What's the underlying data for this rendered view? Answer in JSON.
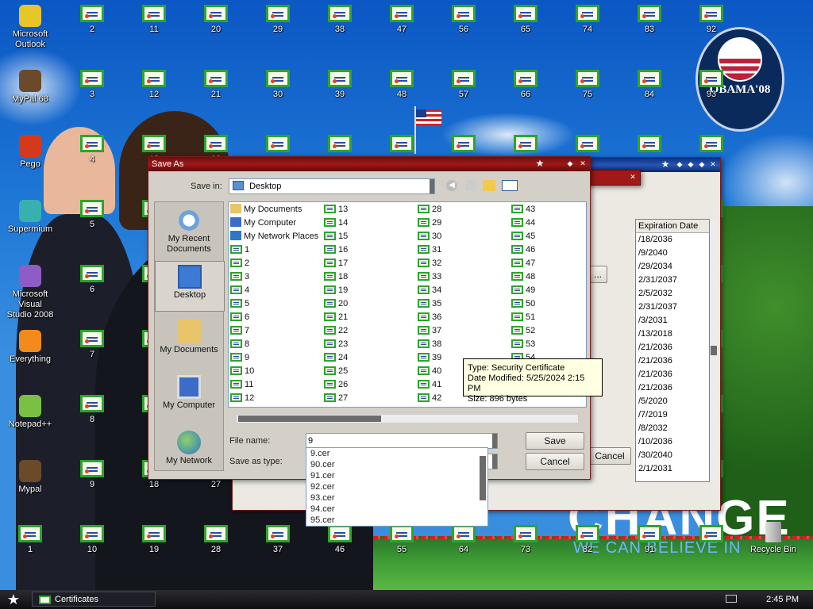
{
  "desktop": {
    "left_icons": [
      {
        "label": "Microsoft\nOutlook",
        "icon": "outlook-icon",
        "color": "#e8c62a"
      },
      {
        "label": "MyPal 68",
        "icon": "mypal-icon",
        "color": "#6b4a2a"
      },
      {
        "label": "Pego",
        "icon": "pego-icon",
        "color": "#d43a1a"
      },
      {
        "label": "Supermium",
        "icon": "supermium-icon",
        "color": "#38b0b0"
      },
      {
        "label": "Microsoft Visual\nStudio 2008",
        "icon": "visual-studio-icon",
        "color": "#8e5cc4"
      },
      {
        "label": "Everything",
        "icon": "everything-icon",
        "color": "#f28a1c"
      },
      {
        "label": "Notepad++",
        "icon": "notepadpp-icon",
        "color": "#7ac143"
      },
      {
        "label": "Mypal",
        "icon": "mypal-icon",
        "color": "#6b4a2a"
      },
      {
        "label": "1",
        "icon": "certificate-icon",
        "color": "#2da52d"
      }
    ],
    "cert_columns": [
      {
        "labels": [
          "2",
          "3",
          "4",
          "5",
          "6",
          "7",
          "8",
          "9",
          "10"
        ]
      },
      {
        "labels": [
          "11",
          "12",
          "13",
          "14",
          "15",
          "16",
          "17",
          "18",
          "19"
        ]
      },
      {
        "labels": [
          "20",
          "21",
          "22",
          "23",
          "24",
          "25",
          "26",
          "27",
          "28"
        ]
      },
      {
        "labels": [
          "29",
          "30",
          "",
          "",
          "",
          "",
          "",
          "",
          "37"
        ]
      },
      {
        "labels": [
          "38",
          "39",
          "",
          "",
          "",
          "",
          "",
          "",
          "46"
        ]
      },
      {
        "labels": [
          "47",
          "48",
          "",
          "",
          "",
          "",
          "",
          "",
          "55"
        ]
      },
      {
        "labels": [
          "56",
          "57",
          "",
          "",
          "",
          "",
          "",
          "",
          "64"
        ]
      },
      {
        "labels": [
          "65",
          "66",
          "",
          "",
          "",
          "",
          "",
          "",
          "73"
        ]
      },
      {
        "labels": [
          "74",
          "75",
          "",
          "",
          "",
          "",
          "",
          "",
          "82"
        ]
      },
      {
        "labels": [
          "83",
          "84",
          "",
          "",
          "",
          "",
          "",
          "",
          "91"
        ]
      },
      {
        "labels": [
          "92",
          "93",
          "",
          "",
          "",
          "",
          "",
          "",
          ""
        ]
      }
    ],
    "recycle_bin": "Recycle Bin",
    "obama_logo_text": "OBAMA'08",
    "wallpaper_text": "CHANGE",
    "wallpaper_subtext": "WE CAN BELIEVE IN"
  },
  "back_window": {
    "expiration_header": "Expiration Date",
    "expiration_dates": [
      "/18/2036",
      "/9/2040",
      "/29/2034",
      "2/31/2037",
      "2/5/2032",
      "2/31/2037",
      "/3/2031",
      "/13/2018",
      "/21/2036",
      "/21/2036",
      "/21/2036",
      "/21/2036",
      "/5/2020",
      "/7/2019",
      "/8/2032",
      "/10/2036",
      "/30/2040",
      "2/1/2031"
    ],
    "button_fragment": "...",
    "cancel_fragment": "Cancel"
  },
  "save_dialog": {
    "title": "Save As",
    "save_in_label": "Save in:",
    "save_in_value": "Desktop",
    "places": [
      "My Recent\nDocuments",
      "Desktop",
      "My Documents",
      "My Computer",
      "My Network"
    ],
    "special_items": [
      "My Documents",
      "My Computer",
      "My Network Places"
    ],
    "file_columns": [
      [
        "1",
        "2",
        "3",
        "4",
        "5",
        "6",
        "7",
        "8",
        "9",
        "10",
        "11",
        "12"
      ],
      [
        "13",
        "14",
        "15",
        "16",
        "17",
        "18",
        "19",
        "20",
        "21",
        "22",
        "23",
        "24",
        "25",
        "26",
        "27"
      ],
      [
        "28",
        "29",
        "30",
        "31",
        "32",
        "33",
        "34",
        "35",
        "36",
        "37",
        "38",
        "39",
        "40",
        "41",
        "42"
      ],
      [
        "43",
        "44",
        "45",
        "46",
        "47",
        "48",
        "49",
        "50",
        "51",
        "52",
        "53",
        "54"
      ]
    ],
    "file_name_label": "File name:",
    "file_name_value": "9",
    "save_as_type_label": "Save as type:",
    "save_button": "Save",
    "cancel_button": "Cancel",
    "autocomplete": [
      "9.cer",
      "90.cer",
      "91.cer",
      "92.cer",
      "93.cer",
      "94.cer",
      "95.cer"
    ],
    "tooltip": {
      "type": "Type: Security Certificate",
      "date": "Date Modified: 5/25/2024 2:15 PM",
      "size": "Size: 896 bytes"
    }
  },
  "taskbar": {
    "task_label": "Certificates",
    "clock": "2:45 PM"
  }
}
